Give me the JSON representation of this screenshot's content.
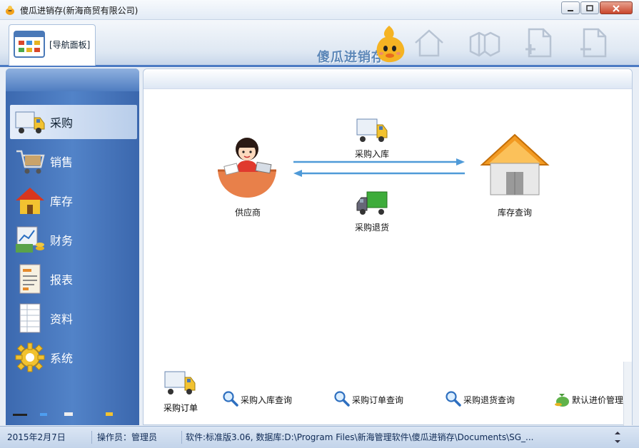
{
  "window": {
    "title": "傻瓜进销存(新海商贸有限公司)",
    "controls": [
      "minimize",
      "maximize",
      "close"
    ]
  },
  "toolbar": {
    "nav_tab_label": "[导航面板]",
    "brand_text": "傻瓜进销存",
    "icons": [
      "home-icon",
      "cubes-icon",
      "add-page-icon",
      "remove-page-icon"
    ]
  },
  "sidebar": {
    "items": [
      {
        "label": "采购",
        "icon": "truck-icon",
        "active": true
      },
      {
        "label": "销售",
        "icon": "cart-icon",
        "active": false
      },
      {
        "label": "库存",
        "icon": "house-icon",
        "active": false
      },
      {
        "label": "财务",
        "icon": "money-icon",
        "active": false
      },
      {
        "label": "报表",
        "icon": "report-icon",
        "active": false
      },
      {
        "label": "资料",
        "icon": "document-icon",
        "active": false
      },
      {
        "label": "系统",
        "icon": "gear-icon",
        "active": false
      }
    ]
  },
  "flow": {
    "supplier_label": "供应商",
    "inbound_label": "采购入库",
    "return_label": "采购退货",
    "stock_label": "库存查询"
  },
  "links": [
    {
      "label": "采购订单",
      "icon": "truck-icon"
    },
    {
      "label": "采购入库查询",
      "icon": "magnifier-icon"
    },
    {
      "label": "采购订单查询",
      "icon": "magnifier-icon"
    },
    {
      "label": "采购退货查询",
      "icon": "magnifier-icon"
    },
    {
      "label": "默认进价管理",
      "icon": "money-bag-icon"
    }
  ],
  "status": {
    "date": "2015年2月7日",
    "operator": "操作员：管理员",
    "software": "软件:标准版3.06,   数据库:D:\\Program Files\\新海管理软件\\傻瓜进销存\\Documents\\SG_..."
  },
  "colors": {
    "accent": "#4c7ac3",
    "sidebar": "#4a78bf",
    "arrow": "#4f9ad8"
  }
}
